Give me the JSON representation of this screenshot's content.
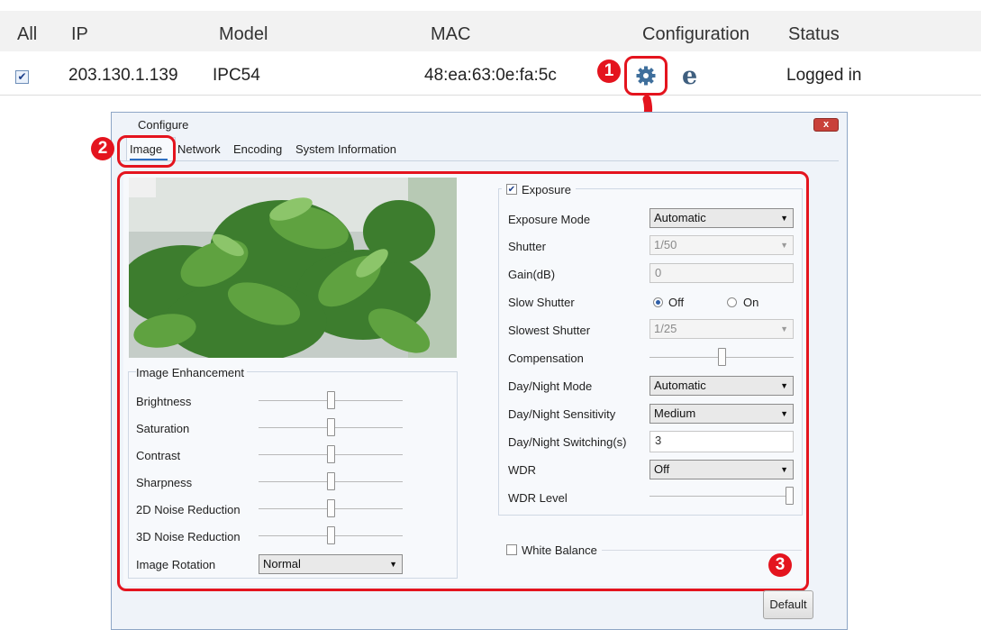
{
  "table": {
    "headers": {
      "all": "All",
      "ip": "IP",
      "model": "Model",
      "mac": "MAC",
      "configuration": "Configuration",
      "status": "Status"
    },
    "row": {
      "ip": "203.130.1.139",
      "model": "IPC54",
      "mac": "48:ea:63:0e:fa:5c",
      "status": "Logged in",
      "checked": "✔"
    }
  },
  "callouts": {
    "one": "1",
    "two": "2",
    "three": "3"
  },
  "icons": {
    "config": "gear-icon",
    "browser": "ie-icon",
    "close": "close-icon",
    "arrow": "curved-arrow"
  },
  "colors": {
    "callout": "#e4141e",
    "close_button": "#c9413a"
  },
  "dialog": {
    "title": "Configure",
    "close_symbol": "x",
    "tabs": [
      "Image",
      "Network",
      "Encoding",
      "System Information"
    ],
    "active_tab": "Image",
    "enhancement": {
      "title": "Image Enhancement",
      "sliders": [
        {
          "label": "Brightness",
          "level": 0.5
        },
        {
          "label": "Saturation",
          "level": 0.5
        },
        {
          "label": "Contrast",
          "level": 0.5
        },
        {
          "label": "Sharpness",
          "level": 0.5
        },
        {
          "label": "2D Noise Reduction",
          "level": 0.5
        },
        {
          "label": "3D Noise Reduction",
          "level": 0.5
        }
      ],
      "rotation_label": "Image Rotation",
      "rotation_value": "Normal"
    },
    "exposure": {
      "title": "Exposure",
      "checked": "✔",
      "mode_label": "Exposure Mode",
      "mode_value": "Automatic",
      "shutter_label": "Shutter",
      "shutter_value": "1/50",
      "gain_label": "Gain(dB)",
      "gain_value": "0",
      "slow_shutter_label": "Slow Shutter",
      "slow_off": "Off",
      "slow_on": "On",
      "slowest_label": "Slowest Shutter",
      "slowest_value": "1/25",
      "compensation_label": "Compensation",
      "compensation_level": 0.5,
      "daynight_mode_label": "Day/Night Mode",
      "daynight_mode_value": "Automatic",
      "daynight_sens_label": "Day/Night Sensitivity",
      "daynight_sens_value": "Medium",
      "daynight_switch_label": "Day/Night Switching(s)",
      "daynight_switch_value": "3",
      "wdr_label": "WDR",
      "wdr_value": "Off",
      "wdr_level_label": "WDR Level",
      "wdr_level": 1.0
    },
    "white_balance": {
      "title": "White Balance"
    },
    "default_button": "Default"
  }
}
